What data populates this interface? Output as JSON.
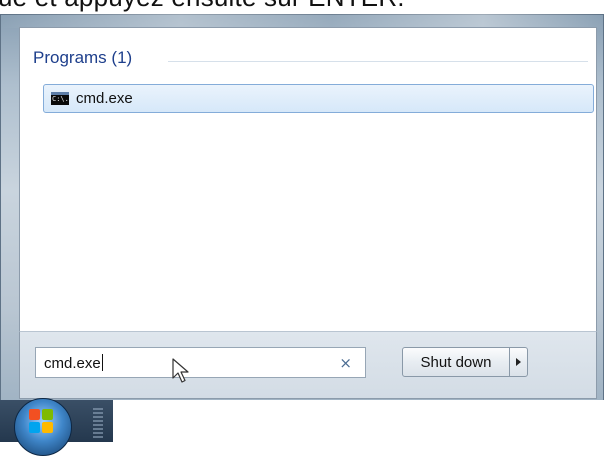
{
  "instruction_text": "ue et appuyez ensuite sur ENTER.",
  "start_menu": {
    "group_header": "Programs (1)",
    "results": [
      {
        "icon": "cmd-icon",
        "icon_text": "C:\\.",
        "label": "cmd.exe"
      }
    ],
    "search": {
      "value": "cmd.exe",
      "clear_icon": "×"
    },
    "shutdown": {
      "label": "Shut down",
      "arrow_icon": "triangle-right-icon"
    }
  },
  "colors": {
    "group_header": "#1e3f8c",
    "selection_border": "#84acd9",
    "selection_fill": "#d6e8f9",
    "clear_icon": "#4a6c92"
  }
}
